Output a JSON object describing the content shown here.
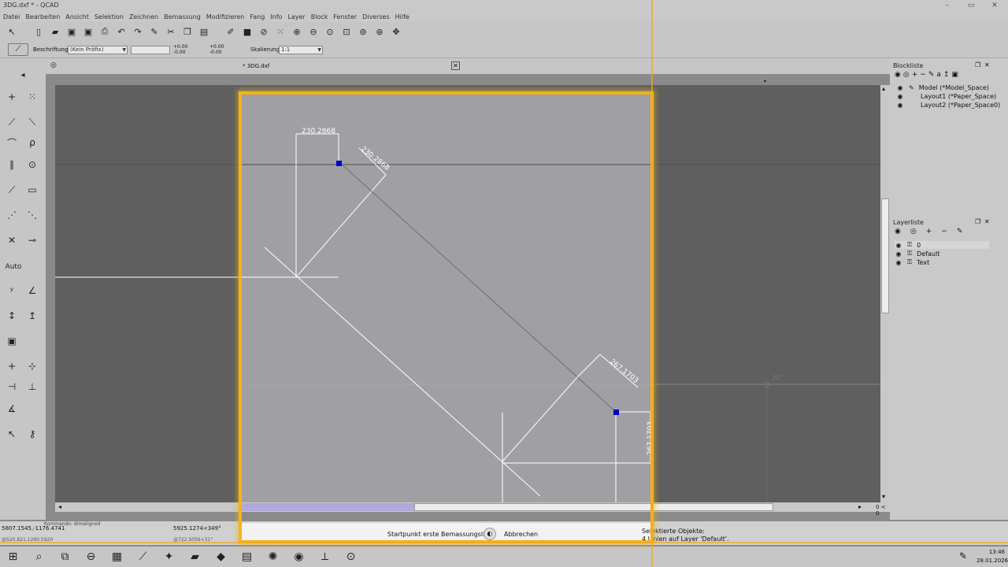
{
  "window": {
    "title": "3DG.dxf * - QCAD",
    "minimize": "–",
    "restore": "▭",
    "close": "✕"
  },
  "menu": [
    "Datei",
    "Bearbeiten",
    "Ansicht",
    "Selektion",
    "Zeichnen",
    "Bemassung",
    "Modifizieren",
    "Fang",
    "Info",
    "Layer",
    "Block",
    "Fenster",
    "Diverses",
    "Hilfe"
  ],
  "options": {
    "label_text": "Beschriftung:",
    "prefix_value": "(Kein Präfix)",
    "tol_upper": "+0.00",
    "tol_lower": "-0.00",
    "tol_upper2": "+0.00",
    "tol_lower2": "-0.00",
    "scale_label": "Skalierung:",
    "scale_value": "1:1"
  },
  "left_toolbar": {
    "back": "◂",
    "auto": "Auto"
  },
  "tabs": {
    "doc_tab": "* 3DG.dxf",
    "close": "✕"
  },
  "dimensions": {
    "top_h": "230.2868",
    "top_aligned": "230.2868",
    "bottom_aligned": "267.1703",
    "bottom_v": "267.1703",
    "angle_marker": "31°"
  },
  "scroll": {
    "readout": "0 < 0"
  },
  "block_panel": {
    "title": "Blockliste",
    "items": [
      "Model (*Model_Space)",
      "Layout1 (*Paper_Space)",
      "Layout2 (*Paper_Space0)"
    ]
  },
  "layer_panel": {
    "title": "Layerliste",
    "items": [
      "0",
      "Default",
      "Text"
    ]
  },
  "status": {
    "coord_abs": "5807.1545,-1176.4741",
    "coord_abs2": "@520.821,1260.5920",
    "coord_polar": "5925.1274<349°",
    "coord_polar2": "@722.5056<31°",
    "cmd_line1": "Kommando: dimaligned",
    "cmd_line2": "Kommando: dimaligned",
    "prompt": "Startpunkt erste Bemassungslinie",
    "cancel": "Abbrechen",
    "selected_label": "Selektierte Objekte:",
    "selected_value": "4 Linien auf Layer 'Default'."
  },
  "taskbar": {
    "time": "13:46",
    "date": "28.01.2026"
  },
  "colors": {
    "highlight": "#f2b416",
    "canvas": "#5f5f5f",
    "paper": "#a0a0a4",
    "entity": "#ffffff",
    "grip": "#0000c8"
  }
}
